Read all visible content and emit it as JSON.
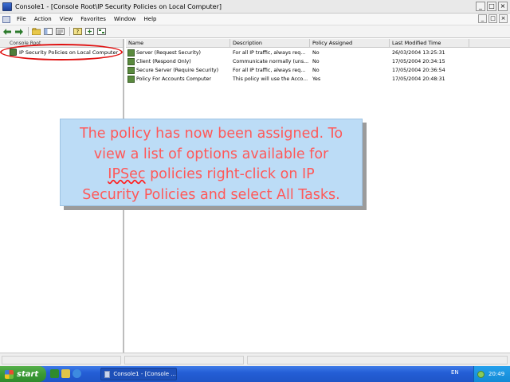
{
  "window": {
    "title": "Console1 - [Console Root\\IP Security Policies on Local Computer]",
    "buttons": {
      "minimize": "_",
      "maximize": "□",
      "close": "×"
    }
  },
  "menubar": {
    "items": [
      "File",
      "Action",
      "View",
      "Favorites",
      "Window",
      "Help"
    ],
    "inner_buttons": {
      "minimize": "_",
      "restore": "□",
      "close": "×"
    }
  },
  "toolbar": {
    "back": "back-icon",
    "forward": "forward-icon"
  },
  "tree": {
    "header": "Console Root",
    "node_label": "IP Security Policies on Local Computer"
  },
  "list": {
    "columns": [
      "Name",
      "Description",
      "Policy Assigned",
      "Last Modified Time"
    ],
    "rows": [
      {
        "name": "Server (Request Security)",
        "description": "For all IP traffic, always req...",
        "assigned": "No",
        "modified": "26/03/2004 13:25:31"
      },
      {
        "name": "Client (Respond Only)",
        "description": "Communicate normally (uns...",
        "assigned": "No",
        "modified": "17/05/2004 20:34:15"
      },
      {
        "name": "Secure Server (Require Security)",
        "description": "For all IP traffic, always req...",
        "assigned": "No",
        "modified": "17/05/2004 20:36:54"
      },
      {
        "name": "Policy For Accounts Computer",
        "description": "This policy will use the Acco...",
        "assigned": "Yes",
        "modified": "17/05/2004 20:48:31"
      }
    ]
  },
  "callout": {
    "line1": "The policy has now been assigned. To",
    "line2": "view a list of options available for",
    "line3_word": "IPSec",
    "line3_rest": " policies right-click on IP",
    "line4": "Security Policies and select All Tasks.",
    "colors": {
      "background": "#bcdcf6",
      "text": "#ff5858"
    }
  },
  "taskbar": {
    "start_label": "start",
    "task_label": "Console1 - [Console ...",
    "language": "EN",
    "clock": "20:49"
  }
}
